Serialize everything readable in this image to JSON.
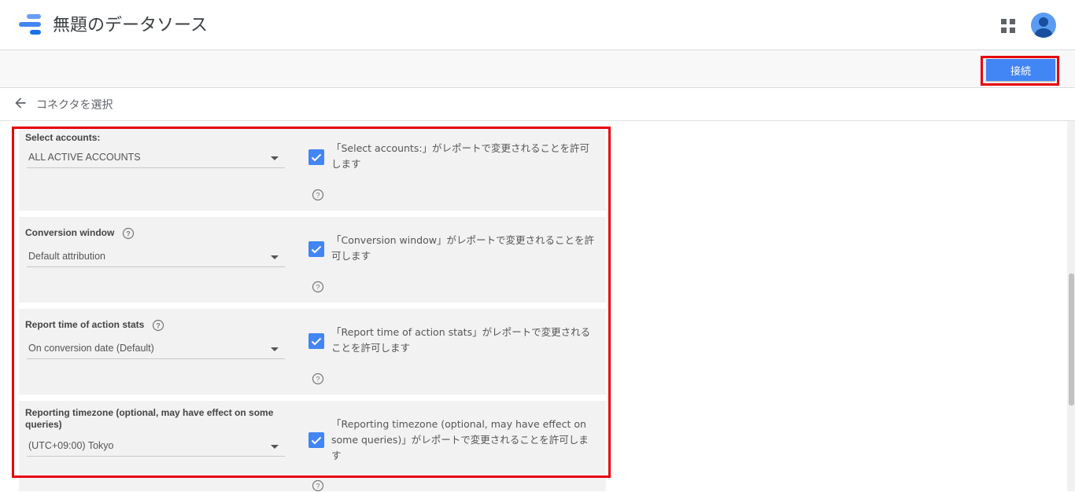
{
  "header": {
    "title": "無題のデータソース",
    "logo_icon": "data-studio-logo",
    "apps_icon": "apps-grid-icon",
    "avatar_icon": "account-avatar-icon"
  },
  "toolbar": {
    "connect_label": "接続"
  },
  "breadcrumb": {
    "back_icon": "arrow-back-icon",
    "label": "コネクタを選択"
  },
  "params": [
    {
      "label": "Select accounts:",
      "has_help": false,
      "value": "ALL ACTIVE ACCOUNTS",
      "allow_change": true,
      "allow_text": "「Select accounts:」がレポートで変更されることを許可します"
    },
    {
      "label": "Conversion window",
      "has_help": true,
      "value": "Default attribution",
      "allow_change": true,
      "allow_text": "「Conversion window」がレポートで変更されることを許可します"
    },
    {
      "label": "Report time of action stats",
      "has_help": true,
      "value": "On conversion date (Default)",
      "allow_change": true,
      "allow_text": "「Report time of action stats」がレポートで変更されることを許可します"
    },
    {
      "label": "Reporting timezone (optional, may have effect on some queries)",
      "has_help": false,
      "value": "(UTC+09:00) Tokyo",
      "allow_change": true,
      "allow_text": "「Reporting timezone (optional, may have effect on some queries)」がレポートで変更されることを許可します"
    }
  ],
  "colors": {
    "accent": "#4285f4",
    "highlight": "#e8000a",
    "card_bg": "#f2f2f2"
  }
}
